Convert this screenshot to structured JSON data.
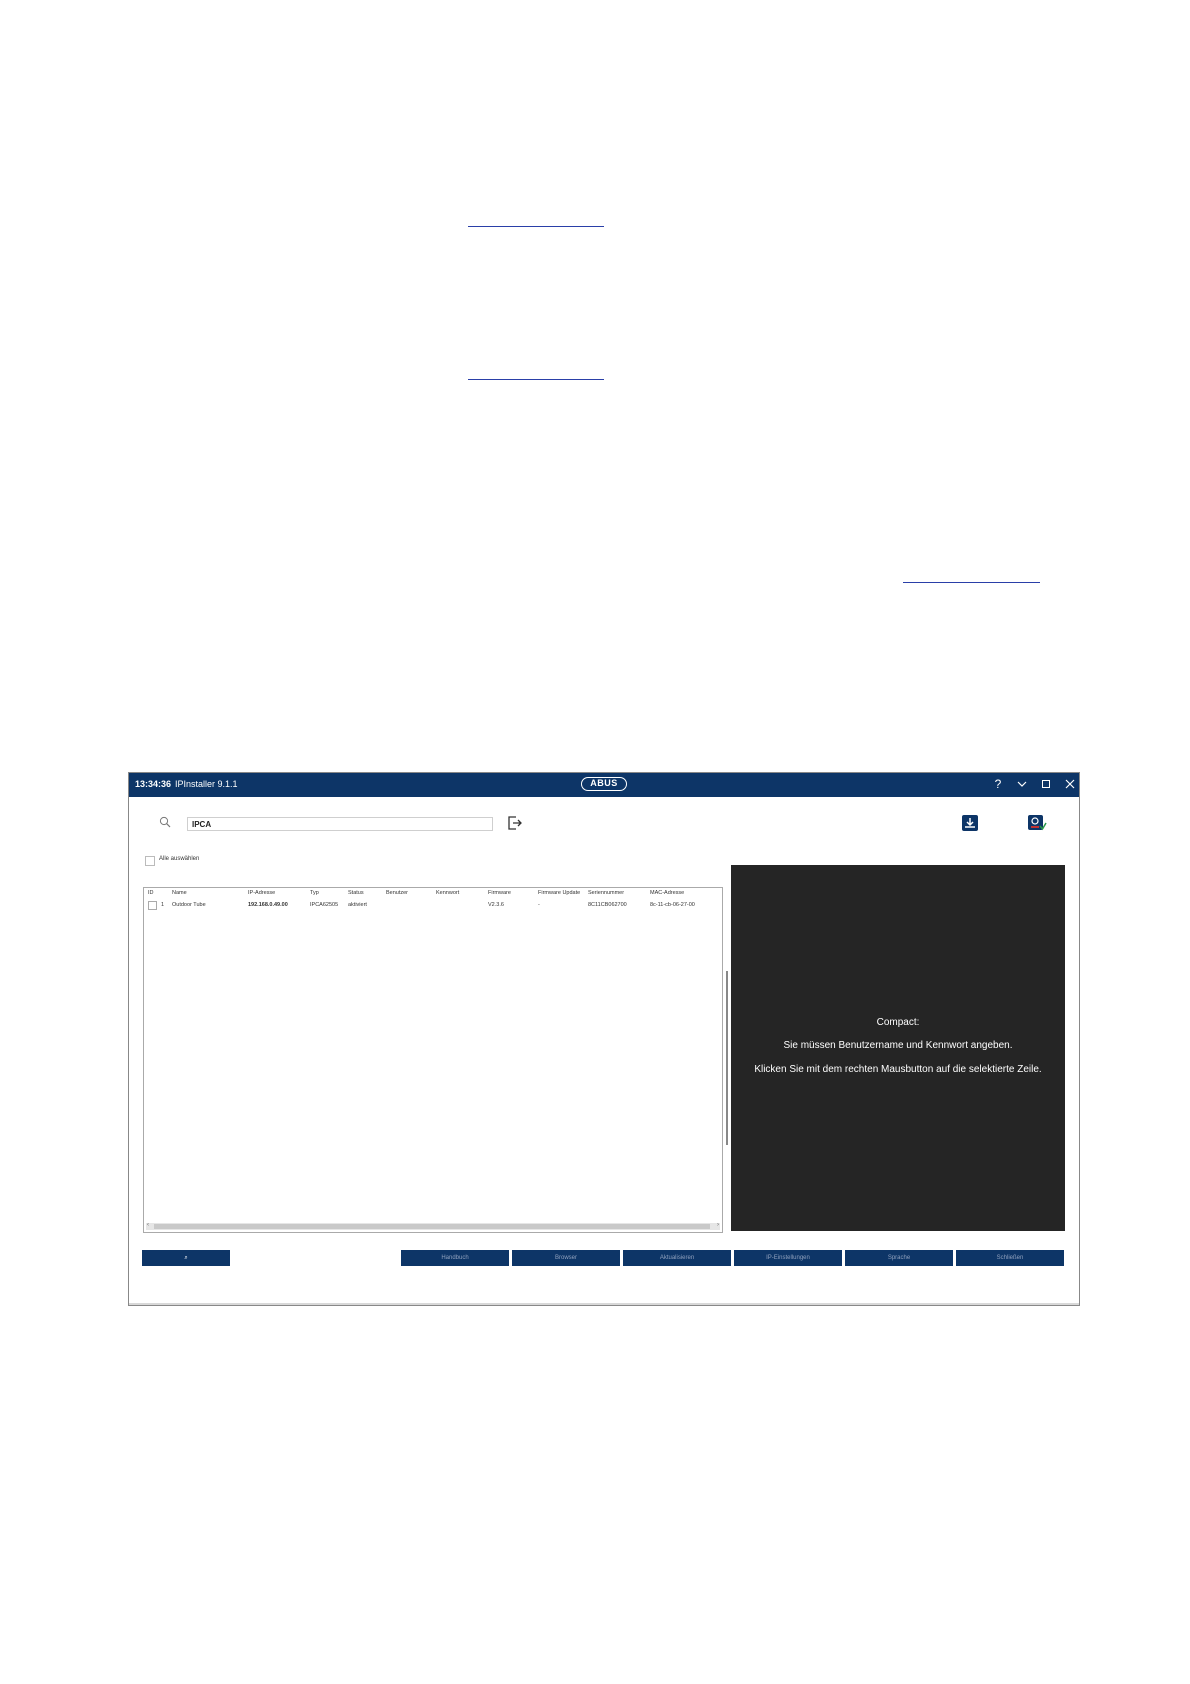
{
  "window": {
    "time": "13:34:36",
    "app_title": "IPInstaller 9.1.1",
    "logo": "ABUS",
    "controls": [
      "?",
      "⌄",
      "□",
      "✕"
    ]
  },
  "toolbar": {
    "search_value": "IPCA",
    "icons": [
      "search-icon",
      "export-icon",
      "download-icon",
      "ipcam-icon"
    ]
  },
  "select_all_label": "Alle auswählen",
  "table": {
    "columns": [
      "ID",
      "Name",
      "IP-Adresse",
      "Typ",
      "Status",
      "Benutzer",
      "Kennwort",
      "Firmware",
      "Firmware Update",
      "Seriennummer",
      "MAC-Adresse"
    ],
    "rows": [
      {
        "id": "1",
        "name": "Outdoor Tube",
        "ip": "192.168.0.49.00",
        "type": "IPCA62505",
        "status": "aktiviert",
        "user": "",
        "password": "",
        "firmware": "V2.3.6",
        "firmware_update": "-",
        "serial": "8C11CB062700",
        "mac": "8c-11-cb-06-27-00"
      }
    ]
  },
  "preview": {
    "line1": "Compact:",
    "line2": "Sie müssen Benutzername und Kennwort angeben.",
    "line3": "Klicken Sie mit dem rechten Mausbutton auf die selektierte Zeile."
  },
  "buttons": {
    "search_glyph": "⌕",
    "handbuch": "Handbuch",
    "browser": "Browser",
    "aktualisieren": "Aktualisieren",
    "ip_einstellungen": "IP-Einstellungen",
    "sprache": "Sprache",
    "schliessen": "Schließen"
  },
  "colors": {
    "titlebar": "#0d3567",
    "preview_bg": "#252525"
  }
}
